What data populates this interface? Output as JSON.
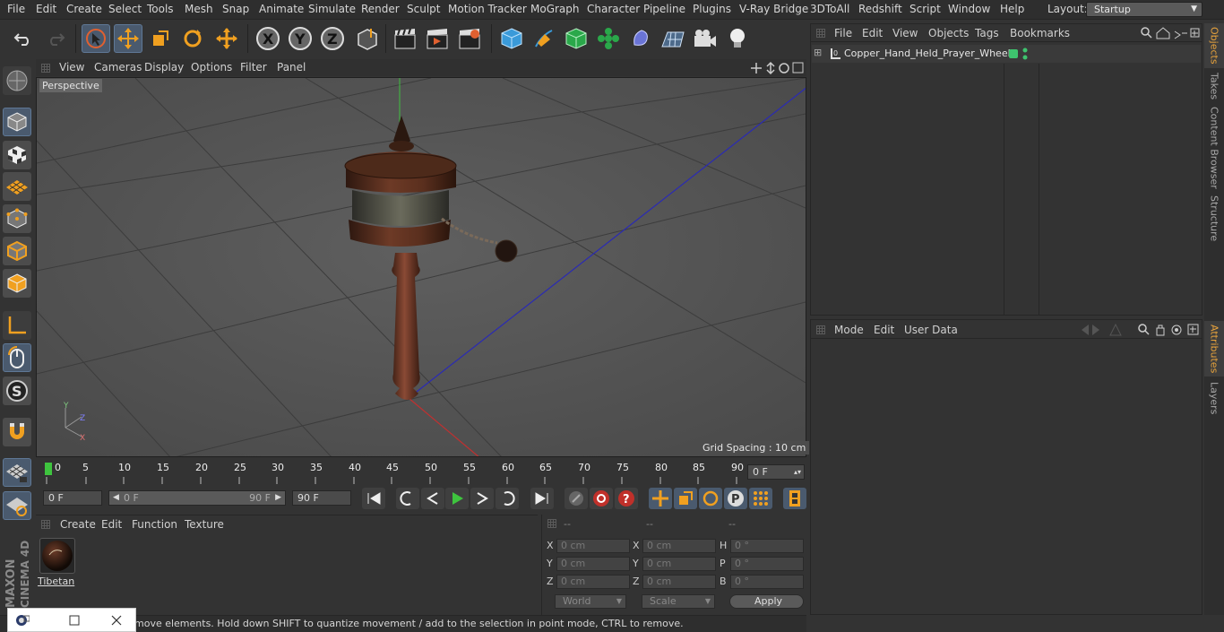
{
  "menubar": {
    "items": [
      "File",
      "Edit",
      "Create",
      "Select",
      "Tools",
      "Mesh",
      "Snap",
      "Animate",
      "Simulate",
      "Render",
      "Sculpt",
      "Motion Tracker",
      "MoGraph",
      "Character",
      "Pipeline",
      "Plugins",
      "V-Ray Bridge",
      "3DToAll",
      "Redshift",
      "Script",
      "Window",
      "Help"
    ],
    "layout_label": "Layout:",
    "layout_value": "Startup"
  },
  "viewport": {
    "menu": [
      "View",
      "Cameras",
      "Display",
      "Options",
      "Filter",
      "Panel"
    ],
    "camera_label": "Perspective",
    "grid_spacing": "Grid Spacing : 10 cm"
  },
  "timeline": {
    "ticks": [
      "0",
      "5",
      "10",
      "15",
      "20",
      "25",
      "30",
      "35",
      "40",
      "45",
      "50",
      "55",
      "60",
      "65",
      "70",
      "75",
      "80",
      "85",
      "90"
    ],
    "current_frame": "0 F"
  },
  "playbar": {
    "start_field": "0 F",
    "range_start": "0 F",
    "range_end": "90 F",
    "end_field": "90 F"
  },
  "material_manager": {
    "menu": [
      "Create",
      "Edit",
      "Function",
      "Texture"
    ],
    "materials": [
      {
        "name": "Tibetan"
      }
    ]
  },
  "coordinates": {
    "headers": [
      "--",
      "--",
      "--"
    ],
    "rows": [
      {
        "l1": "X",
        "v1": "0 cm",
        "l2": "X",
        "v2": "0 cm",
        "l3": "H",
        "v3": "0 °"
      },
      {
        "l1": "Y",
        "v1": "0 cm",
        "l2": "Y",
        "v2": "0 cm",
        "l3": "P",
        "v3": "0 °"
      },
      {
        "l1": "Z",
        "v1": "0 cm",
        "l2": "Z",
        "v2": "0 cm",
        "l3": "B",
        "v3": "0 °"
      }
    ],
    "space_select": "World",
    "mode_select": "Scale",
    "apply_label": "Apply"
  },
  "status": {
    "text": "move elements. Hold down SHIFT to quantize movement / add to the selection in point mode, CTRL to remove."
  },
  "object_manager": {
    "menu": [
      "File",
      "Edit",
      "View",
      "Objects",
      "Tags",
      "Bookmarks"
    ],
    "objects": [
      {
        "name": "Copper_Hand_Held_Prayer_Wheel"
      }
    ]
  },
  "attribute_manager": {
    "menu": [
      "Mode",
      "Edit",
      "User Data"
    ]
  },
  "right_tabs": {
    "objects": "Objects",
    "takes": "Takes",
    "content_browser": "Content Browser",
    "structure": "Structure",
    "attributes": "Attributes",
    "layers": "Layers"
  },
  "branding": {
    "maxon": "MAXON",
    "product": "CINEMA 4D"
  },
  "colors": {
    "accent": "#e8a33c",
    "highlight": "#4a5a6e",
    "play": "#3ec43e"
  }
}
